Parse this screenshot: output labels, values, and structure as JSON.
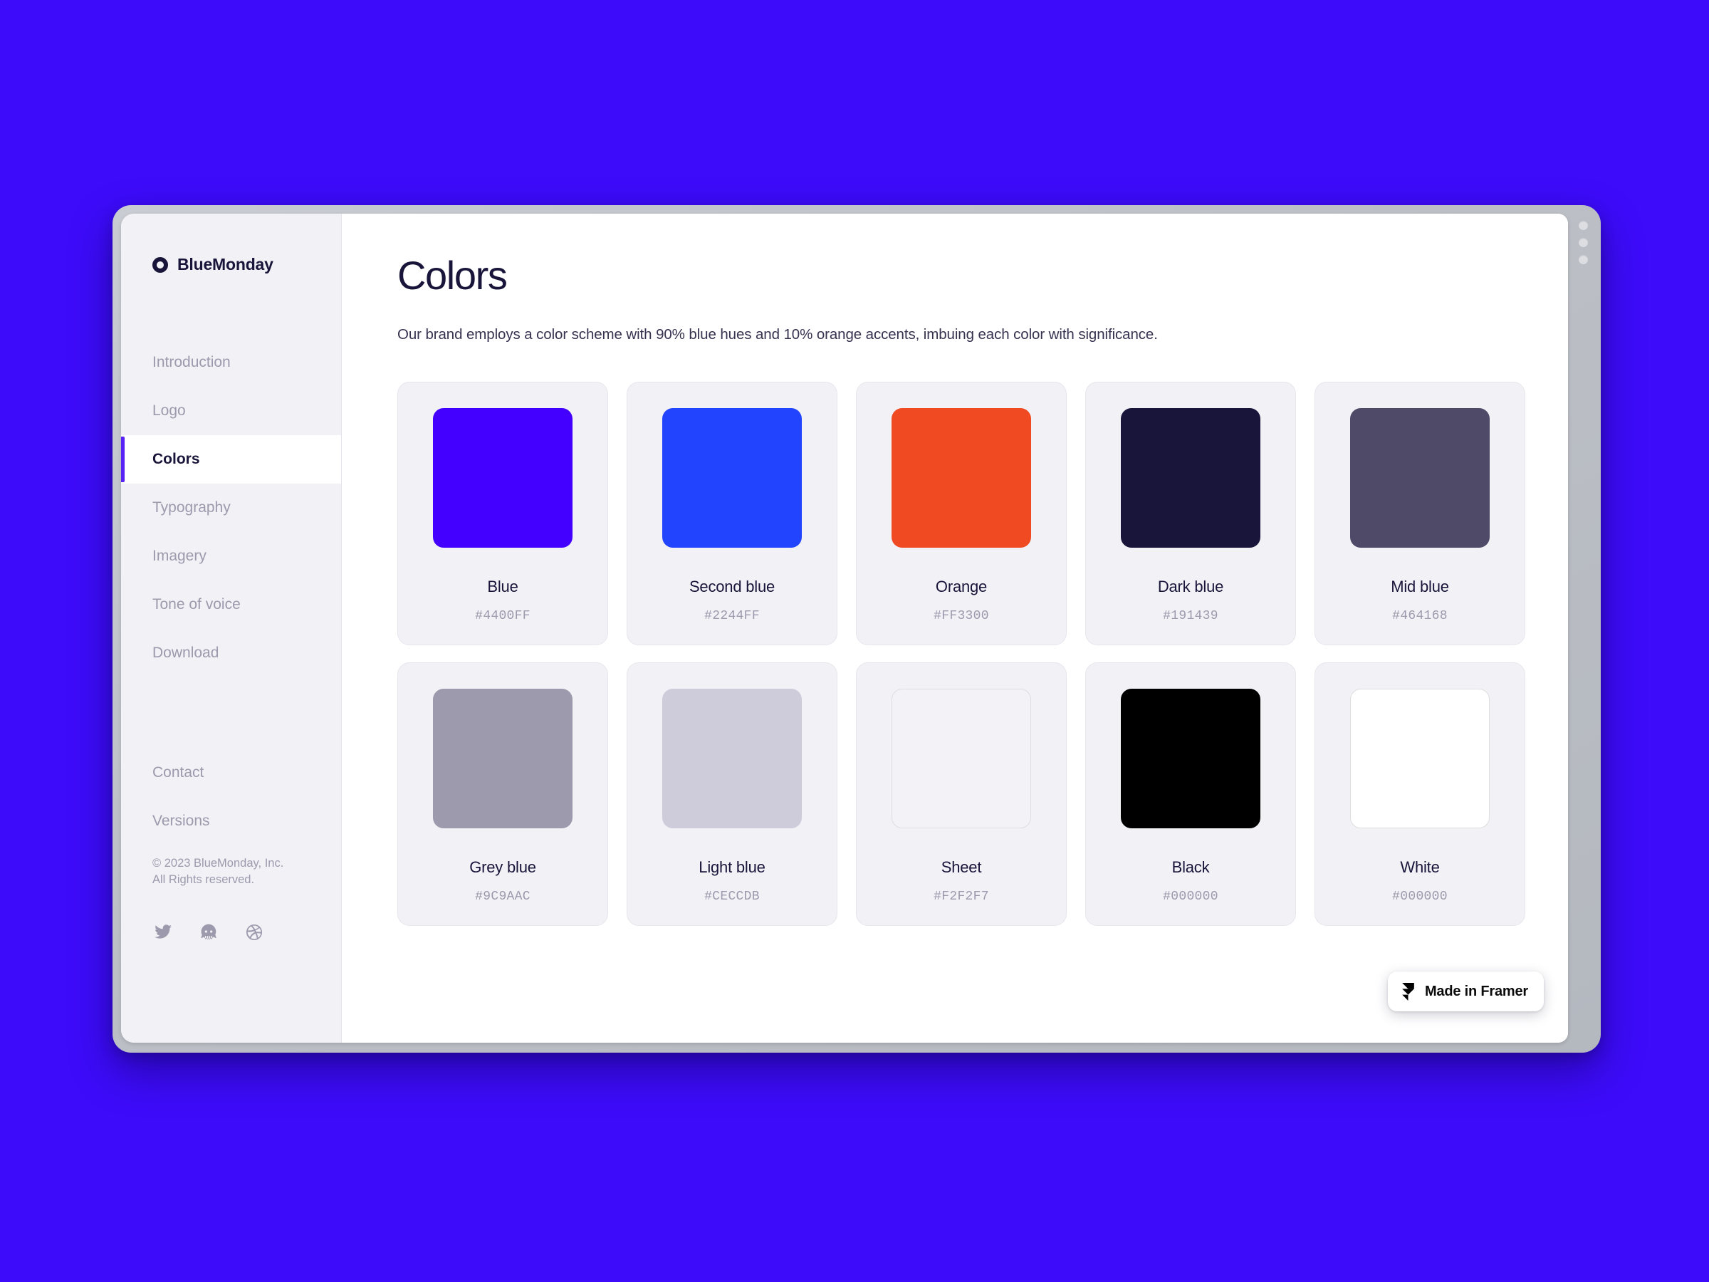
{
  "window": {
    "dots": [
      "window-dot-1",
      "window-dot-2",
      "window-dot-3"
    ]
  },
  "sidebar": {
    "brand": {
      "name": "BlueMonday",
      "logo_icon": "ring-logo-icon"
    },
    "nav": [
      {
        "label": "Introduction",
        "active": false
      },
      {
        "label": "Logo",
        "active": false
      },
      {
        "label": "Colors",
        "active": true
      },
      {
        "label": "Typography",
        "active": false
      },
      {
        "label": "Imagery",
        "active": false
      },
      {
        "label": "Tone of voice",
        "active": false
      },
      {
        "label": "Download",
        "active": false
      }
    ],
    "footer_links": [
      {
        "label": "Contact"
      },
      {
        "label": "Versions"
      }
    ],
    "copyright_line1": "© 2023 BlueMonday, Inc.",
    "copyright_line2": "All Rights reserved.",
    "social": [
      {
        "icon": "twitter-icon",
        "label": "Twitter"
      },
      {
        "icon": "github-icon",
        "label": "GitHub"
      },
      {
        "icon": "dribbble-icon",
        "label": "Dribbble"
      }
    ]
  },
  "main": {
    "title": "Colors",
    "description": "Our brand employs a color scheme with 90% blue hues and 10% orange accents, imbuing each color with significance.",
    "colors": [
      {
        "name": "Blue",
        "hex": "#4400FF",
        "swatch": "#4400FF",
        "outlined": false
      },
      {
        "name": "Second blue",
        "hex": "#2244FF",
        "swatch": "#2244FF",
        "outlined": false
      },
      {
        "name": "Orange",
        "hex": "#FF3300",
        "swatch": "#F04A23",
        "outlined": false
      },
      {
        "name": "Dark blue",
        "hex": "#191439",
        "swatch": "#191439",
        "outlined": false
      },
      {
        "name": "Mid blue",
        "hex": "#464168",
        "swatch": "#4E4A68",
        "outlined": false
      },
      {
        "name": "Grey blue",
        "hex": "#9C9AAC",
        "swatch": "#9C9AAC",
        "outlined": false
      },
      {
        "name": "Light blue",
        "hex": "#CECCDB",
        "swatch": "#CECCDB",
        "outlined": false
      },
      {
        "name": "Sheet",
        "hex": "#F2F2F7",
        "swatch": "#F2F2F7",
        "outlined": true
      },
      {
        "name": "Black",
        "hex": "#000000",
        "swatch": "#000000",
        "outlined": false
      },
      {
        "name": "White",
        "hex": "#000000",
        "swatch": "#FFFFFF",
        "outlined": true
      }
    ]
  },
  "framer_badge": {
    "label": "Made in Framer",
    "icon": "framer-logo-icon"
  },
  "theme": {
    "page_background": "#3D0BFA",
    "accent": "#5822F5",
    "sidebar_background": "#F1F1F6",
    "card_background": "#F1F1F6",
    "text_dark": "#191439",
    "text_muted": "#9C9AAC"
  }
}
